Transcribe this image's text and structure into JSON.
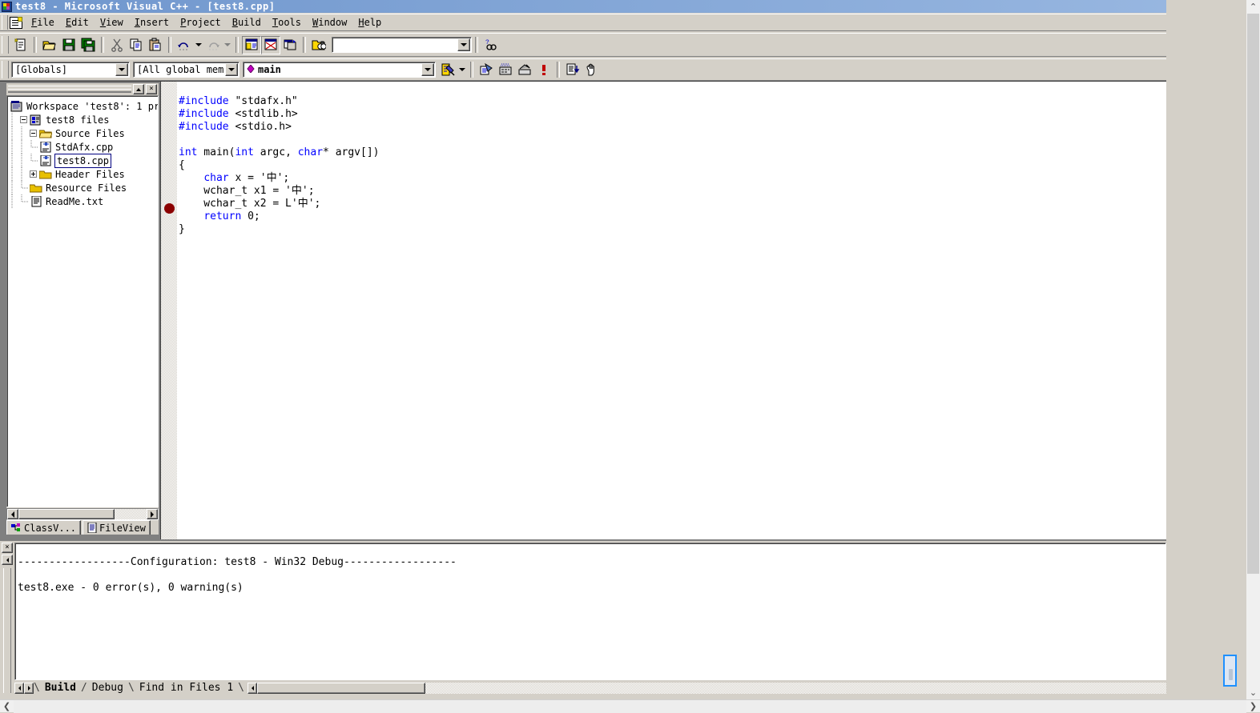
{
  "window": {
    "title": "test8 - Microsoft Visual C++ - [test8.cpp]",
    "icon": "vc-app-icon"
  },
  "menu": {
    "items": [
      {
        "label": "File",
        "accel": "F"
      },
      {
        "label": "Edit",
        "accel": "E"
      },
      {
        "label": "View",
        "accel": "V"
      },
      {
        "label": "Insert",
        "accel": "I"
      },
      {
        "label": "Project",
        "accel": "P"
      },
      {
        "label": "Build",
        "accel": "B"
      },
      {
        "label": "Tools",
        "accel": "T"
      },
      {
        "label": "Window",
        "accel": "W"
      },
      {
        "label": "Help",
        "accel": "H"
      }
    ]
  },
  "toolbar_standard": {
    "buttons": [
      {
        "name": "new-text-file-button",
        "icon": "new-document-icon"
      },
      {
        "name": "open-button",
        "icon": "open-folder-icon"
      },
      {
        "name": "save-button",
        "icon": "floppy-disk-icon"
      },
      {
        "name": "save-all-button",
        "icon": "save-all-icon"
      },
      {
        "name": "cut-button",
        "icon": "scissors-icon"
      },
      {
        "name": "copy-button",
        "icon": "copy-icon"
      },
      {
        "name": "paste-button",
        "icon": "clipboard-paste-icon"
      },
      {
        "name": "undo-button",
        "icon": "undo-arrow-icon"
      },
      {
        "name": "redo-button",
        "icon": "redo-arrow-icon"
      },
      {
        "name": "workspace-toggle-button",
        "icon": "workspace-window-icon"
      },
      {
        "name": "output-toggle-button",
        "icon": "output-window-icon"
      },
      {
        "name": "window-list-button",
        "icon": "window-list-icon"
      },
      {
        "name": "find-in-files-button",
        "icon": "binoculars-icon"
      },
      {
        "name": "search-help-button",
        "icon": "find-help-icon"
      }
    ],
    "find_combo": {
      "value": "",
      "placeholder": ""
    }
  },
  "toolbar_wizardbar": {
    "class_combo": {
      "value": "[Globals]"
    },
    "filter_combo": {
      "value": "[All global members]"
    },
    "member_combo": {
      "value": "main",
      "icon": "member-function-icon"
    },
    "action_button": {
      "name": "wizardbar-action-button",
      "icon": "wizardbar-icon"
    },
    "buttons": [
      {
        "name": "compile-button",
        "icon": "compile-icon"
      },
      {
        "name": "build-button",
        "icon": "build-icon"
      },
      {
        "name": "stop-build-button",
        "icon": "stop-build-icon"
      },
      {
        "name": "execute-program-button",
        "icon": "exclamation-icon"
      },
      {
        "name": "go-button",
        "icon": "go-debug-icon"
      },
      {
        "name": "insert-breakpoint-button",
        "icon": "hand-breakpoint-icon"
      }
    ]
  },
  "workspace": {
    "panel_buttons": [
      {
        "name": "workspace-minimize-button",
        "glyph": "▲"
      },
      {
        "name": "workspace-close-button",
        "glyph": "×"
      }
    ],
    "tree": [
      {
        "label": "Workspace 'test8': 1 pr",
        "depth": 0,
        "icon": "workspace-icon",
        "expander": "none",
        "selected": false
      },
      {
        "label": "test8 files",
        "depth": 1,
        "icon": "project-icon",
        "expander": "minus",
        "selected": false
      },
      {
        "label": "Source Files",
        "depth": 2,
        "icon": "open-folder-icon",
        "expander": "minus",
        "selected": false
      },
      {
        "label": "StdAfx.cpp",
        "depth": 3,
        "icon": "cpp-file-icon",
        "expander": "none",
        "selected": false
      },
      {
        "label": "test8.cpp",
        "depth": 3,
        "icon": "cpp-file-icon",
        "expander": "none",
        "selected": true
      },
      {
        "label": "Header Files",
        "depth": 2,
        "icon": "folder-icon",
        "expander": "plus",
        "selected": false
      },
      {
        "label": "Resource Files",
        "depth": 2,
        "icon": "folder-icon",
        "expander": "none",
        "selected": false
      },
      {
        "label": "ReadMe.txt",
        "depth": 2,
        "icon": "text-file-icon",
        "expander": "none",
        "selected": false
      }
    ],
    "tabs": [
      {
        "label": "ClassV...",
        "icon": "classview-icon",
        "active": false
      },
      {
        "label": "FileView",
        "icon": "fileview-icon",
        "active": true
      }
    ]
  },
  "editor": {
    "filename": "test8.cpp",
    "breakpoint_line": 11,
    "lines": [
      [
        {
          "t": "#include ",
          "k": true
        },
        {
          "t": "\"stdafx.h\"",
          "k": false
        }
      ],
      [
        {
          "t": "#include ",
          "k": true
        },
        {
          "t": "<stdlib.h>",
          "k": false
        }
      ],
      [
        {
          "t": "#include ",
          "k": true
        },
        {
          "t": "<stdio.h>",
          "k": false
        }
      ],
      [],
      [
        {
          "t": "int",
          "k": true
        },
        {
          "t": " main(",
          "k": false
        },
        {
          "t": "int",
          "k": true
        },
        {
          "t": " argc, ",
          "k": false
        },
        {
          "t": "char",
          "k": true
        },
        {
          "t": "* argv[])",
          "k": false
        }
      ],
      [
        {
          "t": "{",
          "k": false
        }
      ],
      [
        {
          "t": "    ",
          "k": false
        },
        {
          "t": "char",
          "k": true
        },
        {
          "t": " x = '中';",
          "k": false
        }
      ],
      [
        {
          "t": "    wchar_t x1 = '中';",
          "k": false
        }
      ],
      [
        {
          "t": "    wchar_t x2 = L'中';",
          "k": false
        }
      ],
      [
        {
          "t": "    ",
          "k": false
        },
        {
          "t": "return",
          "k": true
        },
        {
          "t": " 0;",
          "k": false
        }
      ],
      [
        {
          "t": "}",
          "k": false
        }
      ]
    ]
  },
  "output": {
    "buttons": [
      {
        "name": "output-close-button",
        "glyph": "×"
      },
      {
        "name": "output-scroll-left-button",
        "glyph": "◄"
      }
    ],
    "lines": [
      "------------------Configuration: test8 - Win32 Debug------------------",
      "",
      "test8.exe - 0 error(s), 0 warning(s)"
    ],
    "tabs": [
      {
        "label": "Build",
        "active": true
      },
      {
        "label": "Debug",
        "active": false
      },
      {
        "label": "Find in Files 1",
        "active": false
      }
    ]
  },
  "colors": {
    "keyword": "#0000ff",
    "text": "#000000",
    "face": "#d4d0c8",
    "title_start": "#6f96cd",
    "title_end": "#97b6e0",
    "breakpoint": "#8b0000",
    "selection_border": "#000080"
  }
}
